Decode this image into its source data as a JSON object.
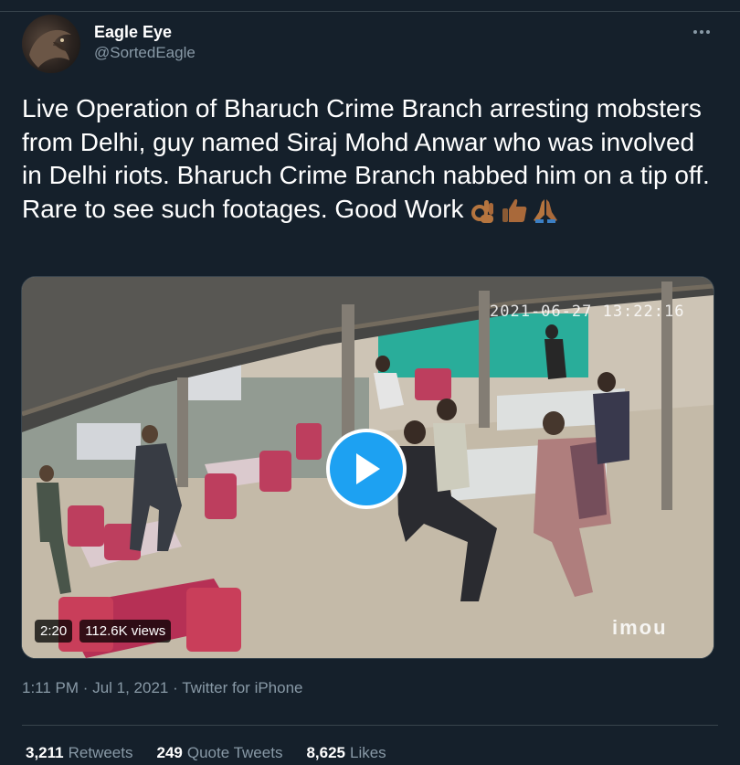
{
  "author": {
    "display_name": "Eagle Eye",
    "handle": "@SortedEagle"
  },
  "tweet": {
    "text": "Live Operation of Bharuch Crime Branch arresting mobsters from Delhi, guy named Siraj Mohd Anwar who was involved in Delhi riots. Bharuch Crime Branch nabbed him on a tip off. Rare to see such footages. Good Work",
    "emojis": [
      "ok-hand-emoji",
      "thumbs-up-emoji",
      "folded-hands-emoji"
    ]
  },
  "video": {
    "duration": "2:20",
    "views": "112.6K views",
    "overlay_timestamp": "2021-06-27 13:22:16",
    "watermark": "imou"
  },
  "meta": {
    "time": "1:11 PM",
    "date": "Jul 1, 2021",
    "source": "Twitter for iPhone",
    "separator": "·"
  },
  "stats": {
    "retweets_count": "3,211",
    "retweets_label": "Retweets",
    "quotes_count": "249",
    "quotes_label": "Quote Tweets",
    "likes_count": "8,625",
    "likes_label": "Likes"
  },
  "colors": {
    "background": "#15202b",
    "accent": "#1da1f2",
    "secondary_text": "#8899a6",
    "border": "#38444d"
  },
  "icons": {
    "more": "more-horizontal-icon",
    "play": "play-icon"
  }
}
